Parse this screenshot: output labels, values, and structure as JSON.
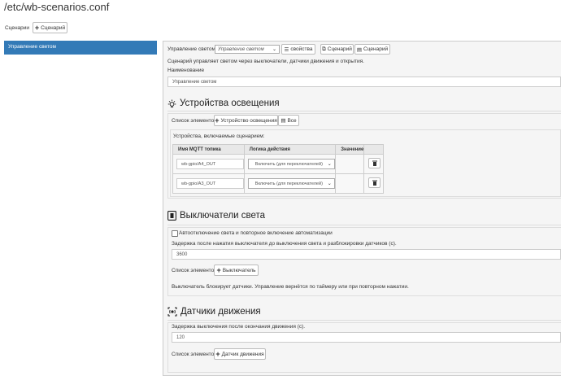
{
  "page": {
    "title": "/etc/wb-scenarios.conf"
  },
  "toolbar": {
    "label": "Сценарии",
    "add_button": "Сценарий"
  },
  "sidebar": {
    "items": [
      {
        "label": "Управление светом"
      }
    ]
  },
  "editor": {
    "type_label": "Управление светом",
    "type_select": "Управление светом",
    "properties_button": "свойства",
    "copy_button": "Сценарий",
    "paste_button": "Сценарий",
    "description": "Сценарий управляет светом через выключатели, датчики движения и открытия.",
    "name_label": "Наименование",
    "name_value": "Управление светом"
  },
  "lighting": {
    "heading": "Устройства освещения",
    "list_label": "Список элементов",
    "add_button": "Устройство освещения",
    "all_button": "Все",
    "subtitle": "Устройства, включаемые сценарием:",
    "columns": [
      "Имя MQTT топика",
      "Логика действия",
      "Значение"
    ],
    "rows": [
      {
        "topic": "wb-gpio/A4_OUT",
        "logic": "Включить (для переключателей)"
      },
      {
        "topic": "wb-gpio/A3_OUT",
        "logic": "Включить (для переключателей)"
      }
    ]
  },
  "switches": {
    "heading": "Выключатели света",
    "auto_checkbox": "Автоотключение света и повторное включение автоматизации",
    "delay_label": "Задержка после нажатия выключателя до выключения света и разблокировки датчиков (с).",
    "delay_value": "3600",
    "list_label": "Список элементов",
    "add_button": "Выключатель",
    "note": "Выключатель блокирует датчики. Управление вернётся по таймеру или при повторном нажатии."
  },
  "motion": {
    "heading": "Датчики движения",
    "delay_label": "Задержка выключения после окончания движения (с).",
    "delay_value": "120",
    "list_label": "Список элементов",
    "add_button": "Датчик движения"
  }
}
